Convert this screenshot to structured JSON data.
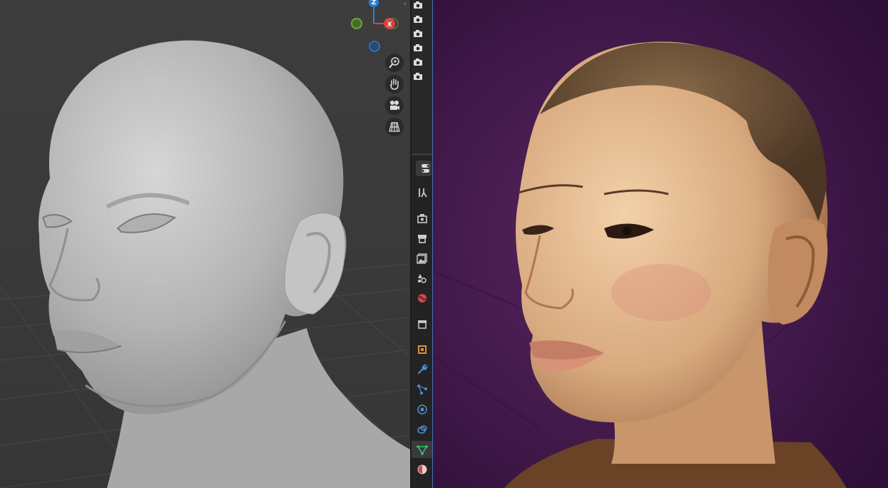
{
  "gizmo": {
    "z_label": "Z",
    "x_label": "X",
    "x_color": "#e03b4b",
    "y_color": "#70a92e",
    "z_color": "#2d7fd4"
  },
  "navigation": {
    "buttons": [
      {
        "name": "zoom",
        "icon": "magnifier-plus-icon"
      },
      {
        "name": "pan",
        "icon": "hand-icon"
      },
      {
        "name": "camera-view",
        "icon": "movie-camera-icon"
      },
      {
        "name": "perspective-toggle",
        "icon": "grid-perspective-icon"
      }
    ]
  },
  "outliner": {
    "visibility_icon": "camera-icon",
    "rows": 6
  },
  "properties_tabs": [
    {
      "name": "tool",
      "icon": "tool-icon"
    },
    {
      "name": "render",
      "icon": "render-icon"
    },
    {
      "name": "output",
      "icon": "printer-icon"
    },
    {
      "name": "view-layer",
      "icon": "images-icon"
    },
    {
      "name": "scene",
      "icon": "scene-icon"
    },
    {
      "name": "world",
      "icon": "world-icon"
    },
    {
      "name": "collection",
      "icon": "collection-icon"
    },
    {
      "name": "object",
      "icon": "object-icon"
    },
    {
      "name": "modifiers",
      "icon": "wrench-icon"
    },
    {
      "name": "particles",
      "icon": "particles-icon"
    },
    {
      "name": "physics",
      "icon": "physics-icon"
    },
    {
      "name": "constraints",
      "icon": "constraints-icon"
    },
    {
      "name": "data",
      "icon": "mesh-data-icon",
      "active": true
    },
    {
      "name": "material",
      "icon": "material-icon"
    }
  ],
  "colors": {
    "accent": "#4772b3",
    "panel_bg": "#232323",
    "viewport_bg": "#3d3d3d"
  }
}
